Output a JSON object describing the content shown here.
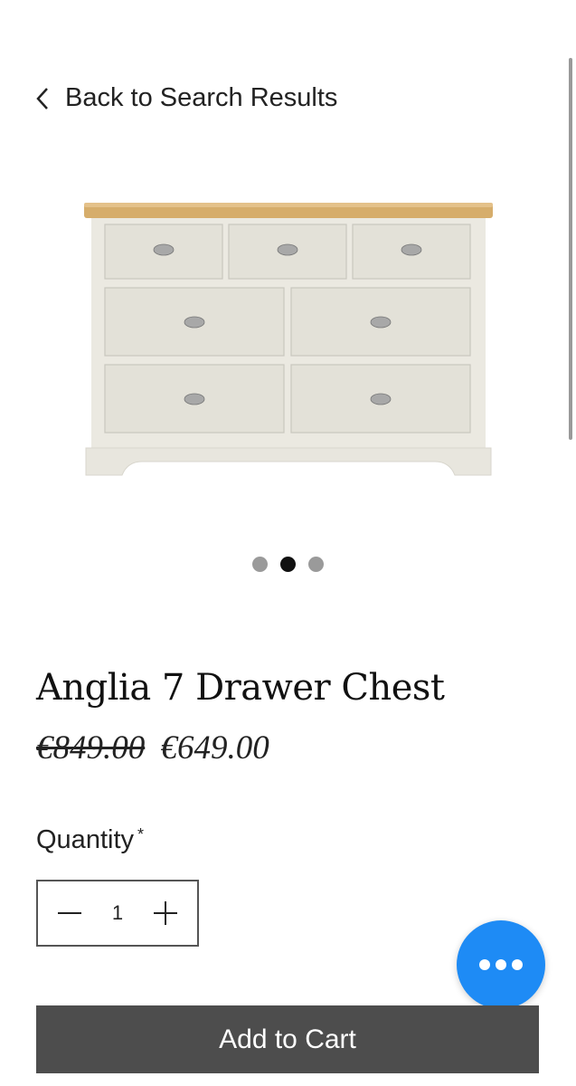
{
  "nav": {
    "back_label": "Back to Search Results"
  },
  "gallery": {
    "slide_count": 3,
    "active_slide": 2,
    "image": "white-7-drawer-chest-with-oak-top"
  },
  "product": {
    "title": "Anglia 7 Drawer Chest",
    "original_price": "€849.00",
    "sale_price": "€649.00"
  },
  "quantity": {
    "label": "Quantity",
    "required_mark": "*",
    "value": "1"
  },
  "actions": {
    "add_to_cart_label": "Add to Cart"
  },
  "colors": {
    "fab": "#1e8bf5",
    "cart_button": "#4d4d4d",
    "active_dot": "#111111",
    "inactive_dot": "#9a9a9a"
  }
}
